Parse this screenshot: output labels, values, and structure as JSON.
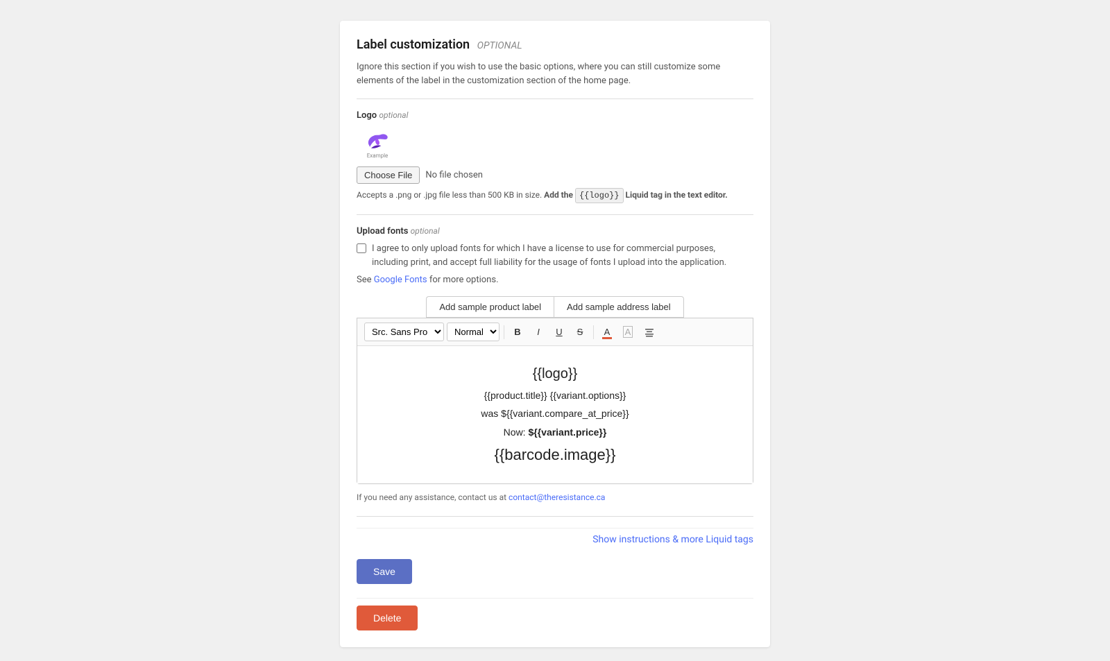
{
  "page": {
    "section_title": "Label customization",
    "optional_tag": "OPTIONAL",
    "description": "Ignore this section if you wish to use the basic options, where you can still customize some elements of the label in the customization section of the home page.",
    "logo": {
      "label": "Logo",
      "optional": "optional",
      "example_text": "Example",
      "choose_file_btn": "Choose File",
      "no_file_text": "No file chosen",
      "hint_part1": "Accepts a .png or .jpg file less than 500 KB in size.",
      "add_the": "Add the",
      "liquid_tag": "{{logo}}",
      "hint_part2": "Liquid tag in the text editor."
    },
    "upload_fonts": {
      "label": "Upload fonts",
      "optional": "optional",
      "checkbox_text": "I agree to only upload fonts for which I have a license to use for commercial purposes, including print, and accept full liability for the usage of fonts I upload into the application.",
      "see_text": "See",
      "google_fonts_link": "Google Fonts",
      "see_more": "for more options."
    },
    "editor": {
      "btn_add_product": "Add sample product label",
      "btn_add_address": "Add sample address label",
      "font_select": "Src. Sans Pro",
      "style_select": "Normal",
      "toolbar": {
        "bold": "B",
        "italic": "I",
        "underline": "U",
        "strikethrough": "S"
      },
      "content_lines": [
        {
          "text": "{{logo}}",
          "style": "large"
        },
        {
          "text": "{{product.title}} {{variant.options}}",
          "style": "normal"
        },
        {
          "text": "was ${{variant.compare_at_price}}",
          "style": "normal"
        },
        {
          "text": "Now: ${{variant.price}}",
          "style": "normal bold-text"
        },
        {
          "text": "{{barcode.image}}",
          "style": "barcode-line"
        }
      ],
      "assistance_text": "If you need any assistance, contact us at",
      "contact_email": "contact@theresistance.ca",
      "show_instructions": "Show instructions & more Liquid tags"
    },
    "buttons": {
      "save": "Save",
      "delete": "Delete"
    }
  }
}
